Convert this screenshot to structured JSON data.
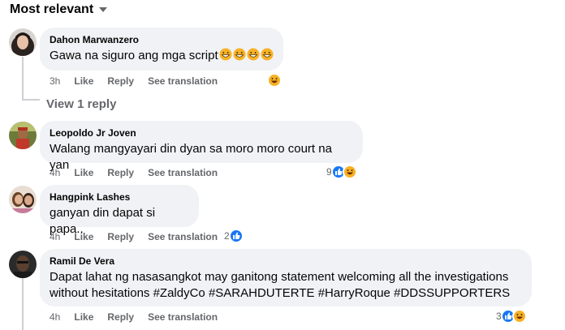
{
  "header": {
    "sort_label": "Most relevant"
  },
  "comments": [
    {
      "author": "Dahon Marwanzero",
      "text": "Gawa na siguro ang mga script",
      "time": "3h",
      "like": "Like",
      "reply": "Reply",
      "translate": "See translation",
      "reaction_count": "",
      "reactions": [
        "haha"
      ]
    },
    {
      "author": "Leopoldo Jr Joven",
      "text": "Walang mangyayari din dyan sa moro moro court na yan",
      "time": "4h",
      "like": "Like",
      "reply": "Reply",
      "translate": "See translation",
      "reaction_count": "9",
      "reactions": [
        "like",
        "haha"
      ]
    },
    {
      "author": "Hangpink Lashes",
      "text": "ganyan din dapat si papa..",
      "time": "4h",
      "like": "Like",
      "reply": "Reply",
      "translate": "See translation",
      "reaction_count": "2",
      "reactions": [
        "like"
      ]
    },
    {
      "author": "Ramil De Vera",
      "text_line1": "Dapat lahat ng nasasangkot may ganitong statement welcoming all the investigations",
      "text_line2": "without hesitations #ZaldyCo #SARAHDUTERTE #HarryRoque #DDSSUPPORTERS",
      "time": "4h",
      "like": "Like",
      "reply": "Reply",
      "translate": "See translation",
      "reaction_count": "3",
      "reactions": [
        "like",
        "haha"
      ]
    }
  ],
  "view_replies": "View 1 reply",
  "colors": {
    "bubble": "#f0f2f5",
    "muted": "#65676b",
    "like_blue": "#1877f2",
    "haha_yellow": "#f7b125"
  },
  "icons": [
    "caret-down-icon",
    "like-reaction-icon",
    "haha-reaction-icon",
    "grinning-emoji-icon"
  ]
}
